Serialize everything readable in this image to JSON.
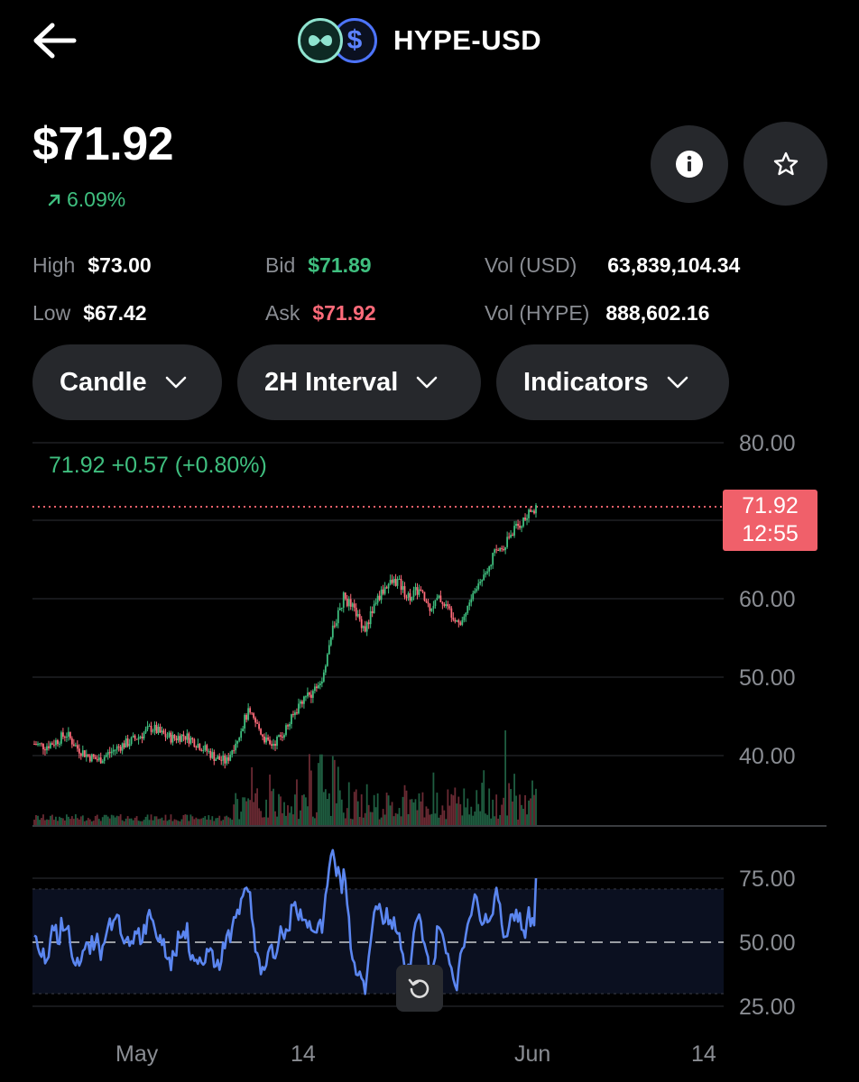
{
  "header": {
    "pair": "HYPE-USD"
  },
  "price": {
    "current": "$71.92",
    "change": "6.09%"
  },
  "stats": [
    {
      "label": "High",
      "value": "$73.00"
    },
    {
      "label": "Low",
      "value": "$67.42"
    },
    {
      "label": "Bid",
      "value": "$71.89"
    },
    {
      "label": "Ask",
      "value": "$71.92"
    },
    {
      "label": "Vol (USD)",
      "value": "63,839,104.34"
    },
    {
      "label": "Vol (HYPE)",
      "value": "888,602.16"
    }
  ],
  "controls": {
    "chart_type": "Candle",
    "interval": "2H Interval",
    "indicators": "Indicators"
  },
  "chart": {
    "ohlc_summary": "71.92 +0.57 (+0.80%)",
    "price_tag": {
      "price": "71.92",
      "countdown": "12:55"
    },
    "y_labels": [
      "80.00",
      "60.00",
      "50.00",
      "40.00"
    ],
    "rsi_labels": [
      "75.00",
      "50.00",
      "25.00"
    ],
    "x_labels": [
      "May",
      "14",
      "Jun",
      "14"
    ]
  },
  "colors": {
    "up": "#3fbf7f",
    "down": "#ff6b7a",
    "rsi_line": "#5b86f0",
    "price_tag": "#f0606a"
  },
  "icons": {
    "back": "arrow-left-icon",
    "info": "info-icon",
    "star": "star-icon",
    "reset": "rotate-ccw-icon"
  },
  "chart_data": {
    "type": "candlestick",
    "ylim": [
      40,
      80
    ],
    "last_price": 71.92,
    "price_series": [
      41.5,
      41.2,
      41.8,
      42.8,
      41.0,
      40.0,
      39.4,
      40.3,
      41.2,
      41.8,
      42.6,
      43.6,
      42.7,
      42.2,
      42.6,
      41.8,
      40.8,
      39.7,
      39.2,
      42.3,
      45.5,
      43.6,
      41.2,
      42.3,
      44.4,
      47.0,
      48.1,
      50.1,
      56.2,
      60.3,
      58.5,
      56.2,
      59.7,
      61.8,
      62.4,
      60.3,
      61.2,
      59.0,
      60.1,
      58.4,
      57.0,
      60.3,
      62.9,
      65.6,
      67.0,
      68.9,
      70.3,
      71.9
    ],
    "rsi": {
      "levels": [
        25,
        50,
        75
      ],
      "band": [
        30,
        70
      ],
      "last": 75
    },
    "x_axis": [
      "May",
      "14",
      "Jun",
      "14"
    ]
  }
}
